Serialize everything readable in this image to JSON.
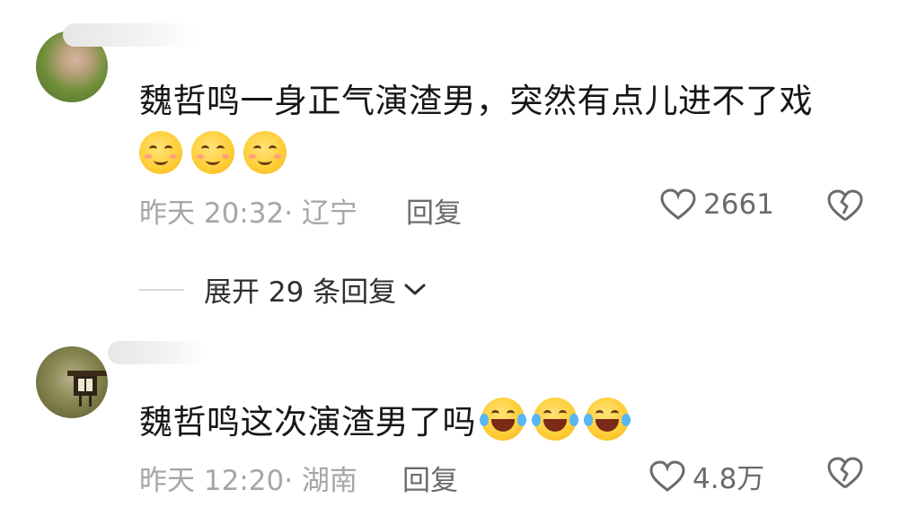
{
  "comments": [
    {
      "text": "魏哲鸣一身正气演渣男，突然有点儿进不了戏",
      "emojis": [
        "smile-blush-emoji",
        "smile-blush-emoji",
        "smile-blush-emoji"
      ],
      "meta": "昨天 20:32· 辽宁",
      "reply_label": "回复",
      "likes": "2661"
    },
    {
      "text": "魏哲鸣这次演渣男了吗",
      "emojis": [
        "laugh-tears-emoji",
        "laugh-tears-emoji",
        "laugh-tears-emoji"
      ],
      "meta": "昨天 12:20· 湖南",
      "reply_label": "回复",
      "likes": "4.8万"
    }
  ],
  "expand_replies": {
    "label": "展开 29 条回复"
  },
  "colors": {
    "text": "#161616",
    "meta": "#a6a6a6",
    "action": "#6b6b6b",
    "emoji": "#ffcf3a"
  }
}
